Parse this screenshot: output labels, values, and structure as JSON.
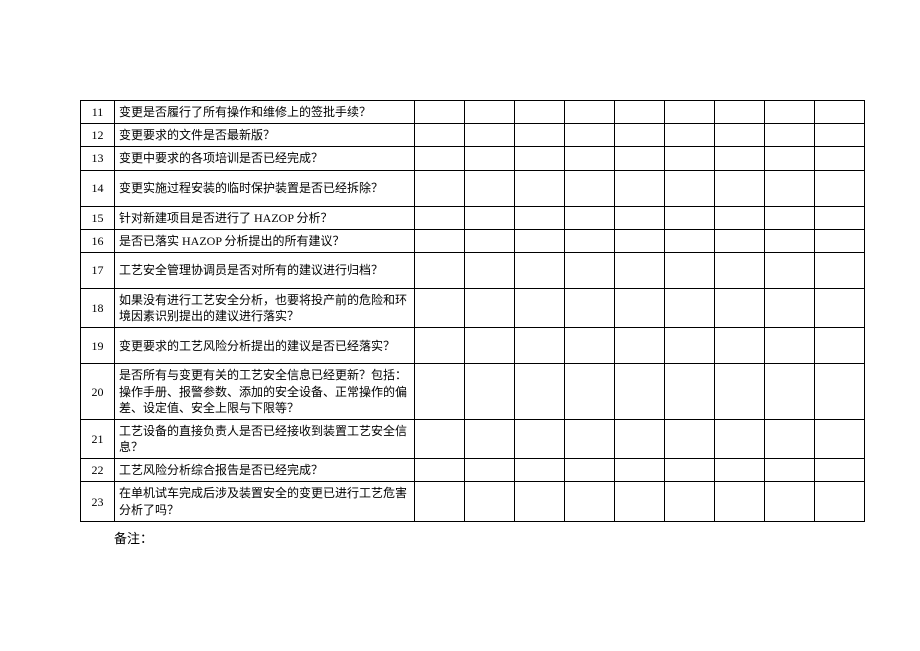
{
  "chart_data": {
    "type": "table",
    "rows": [
      {
        "no": "11",
        "question": "变更是否履行了所有操作和维修上的签批手续？",
        "cols": [
          "",
          "",
          "",
          "",
          "",
          "",
          "",
          "",
          ""
        ]
      },
      {
        "no": "12",
        "question": "变更要求的文件是否最新版？",
        "cols": [
          "",
          "",
          "",
          "",
          "",
          "",
          "",
          "",
          ""
        ]
      },
      {
        "no": "13",
        "question": "变更中要求的各项培训是否已经完成？",
        "cols": [
          "",
          "",
          "",
          "",
          "",
          "",
          "",
          "",
          ""
        ]
      },
      {
        "no": "14",
        "question": "变更实施过程安装的临时保护装置是否已经拆除？",
        "cols": [
          "",
          "",
          "",
          "",
          "",
          "",
          "",
          "",
          ""
        ]
      },
      {
        "no": "15",
        "question": "针对新建项目是否进行了 HAZOP 分析？",
        "cols": [
          "",
          "",
          "",
          "",
          "",
          "",
          "",
          "",
          ""
        ]
      },
      {
        "no": "16",
        "question": "是否已落实 HAZOP 分析提出的所有建议？",
        "cols": [
          "",
          "",
          "",
          "",
          "",
          "",
          "",
          "",
          ""
        ]
      },
      {
        "no": "17",
        "question": "工艺安全管理协调员是否对所有的建议进行归档？",
        "cols": [
          "",
          "",
          "",
          "",
          "",
          "",
          "",
          "",
          ""
        ]
      },
      {
        "no": "18",
        "question": "如果没有进行工艺安全分析，也要将投产前的危险和环境因素识别提出的建议进行落实？",
        "cols": [
          "",
          "",
          "",
          "",
          "",
          "",
          "",
          "",
          ""
        ]
      },
      {
        "no": "19",
        "question": "变更要求的工艺风险分析提出的建议是否已经落实？",
        "cols": [
          "",
          "",
          "",
          "",
          "",
          "",
          "",
          "",
          ""
        ]
      },
      {
        "no": "20",
        "question": "是否所有与变更有关的工艺安全信息已经更新？包括：操作手册、报警参数、添加的安全设备、正常操作的偏差、设定值、安全上限与下限等？",
        "cols": [
          "",
          "",
          "",
          "",
          "",
          "",
          "",
          "",
          ""
        ]
      },
      {
        "no": "21",
        "question": "工艺设备的直接负责人是否已经接收到装置工艺安全信息？",
        "cols": [
          "",
          "",
          "",
          "",
          "",
          "",
          "",
          "",
          ""
        ]
      },
      {
        "no": "22",
        "question": "工艺风险分析综合报告是否已经完成？",
        "cols": [
          "",
          "",
          "",
          "",
          "",
          "",
          "",
          "",
          ""
        ]
      },
      {
        "no": "23",
        "question": "在单机试车完成后涉及装置安全的变更已进行工艺危害分析了吗？",
        "cols": [
          "",
          "",
          "",
          "",
          "",
          "",
          "",
          "",
          ""
        ]
      }
    ]
  },
  "note_label": "备注："
}
